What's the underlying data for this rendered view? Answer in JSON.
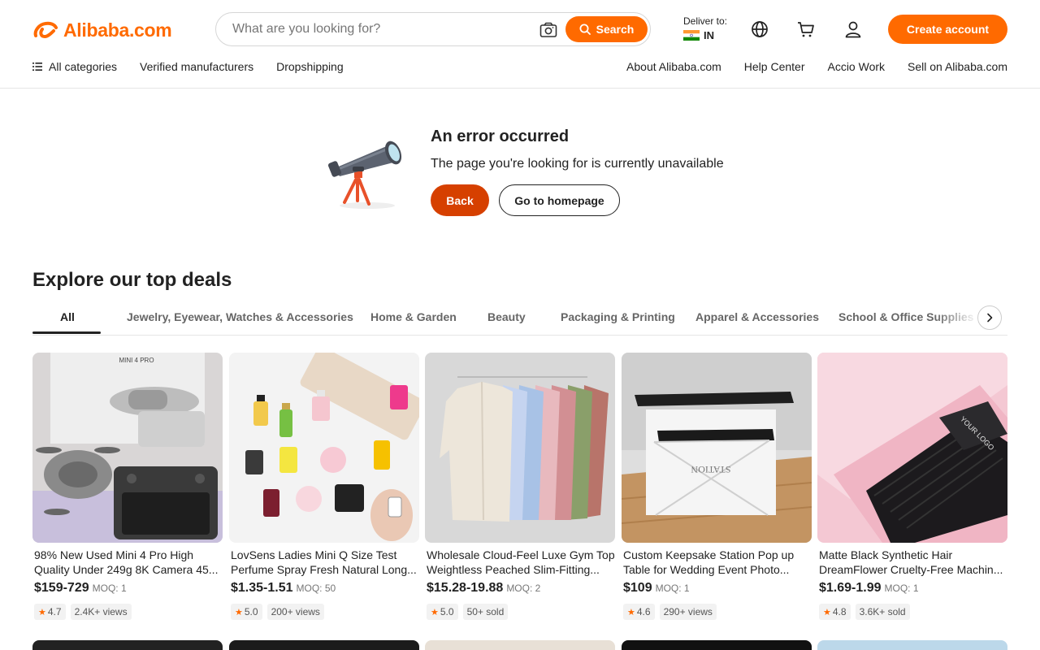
{
  "header": {
    "logo_text": "Alibaba.com",
    "search_placeholder": "What are you looking for?",
    "search_button": "Search",
    "deliver_label": "Deliver to:",
    "deliver_country": "IN",
    "create_account": "Create account"
  },
  "nav": {
    "all_categories": "All categories",
    "left": [
      "Verified manufacturers",
      "Dropshipping"
    ],
    "right": [
      "About Alibaba.com",
      "Help Center",
      "Accio Work",
      "Sell on Alibaba.com"
    ]
  },
  "error": {
    "title": "An error occurred",
    "message": "The page you're looking for is currently unavailable",
    "back": "Back",
    "home": "Go to homepage"
  },
  "deals": {
    "title": "Explore our top deals",
    "tabs": [
      "All",
      "Jewelry, Eyewear, Watches & Accessories",
      "Home & Garden",
      "Beauty",
      "Packaging & Printing",
      "Apparel & Accessories",
      "School & Office Supplies"
    ],
    "products": [
      {
        "title": "98% New Used Mini 4 Pro High Quality Under 249g 8K Camera 45...",
        "price": "$159-729",
        "moq": "MOQ: 1",
        "rating": "4.7",
        "stat": "2.4K+ views",
        "image_label": "MINI 4 PRO"
      },
      {
        "title": "LovSens Ladies Mini Q Size Test Perfume Spray Fresh Natural Long...",
        "price": "$1.35-1.51",
        "moq": "MOQ: 50",
        "rating": "5.0",
        "stat": "200+ views"
      },
      {
        "title": "Wholesale Cloud-Feel Luxe Gym Top Weightless Peached Slim-Fitting...",
        "price": "$15.28-19.88",
        "moq": "MOQ: 2",
        "rating": "5.0",
        "stat": "50+ sold"
      },
      {
        "title": "Custom Keepsake Station Pop up Table for Wedding Event Photo...",
        "price": "$109",
        "moq": "MOQ: 1",
        "rating": "4.6",
        "stat": "290+ views"
      },
      {
        "title": "Matte Black Synthetic Hair DreamFlower Cruelty-Free Machin...",
        "price": "$1.69-1.99",
        "moq": "MOQ: 1",
        "rating": "4.8",
        "stat": "3.6K+ sold",
        "image_label": "YOUR LOGO"
      }
    ]
  },
  "colors": {
    "brand": "#ff6a00",
    "back_button": "#d64000"
  }
}
